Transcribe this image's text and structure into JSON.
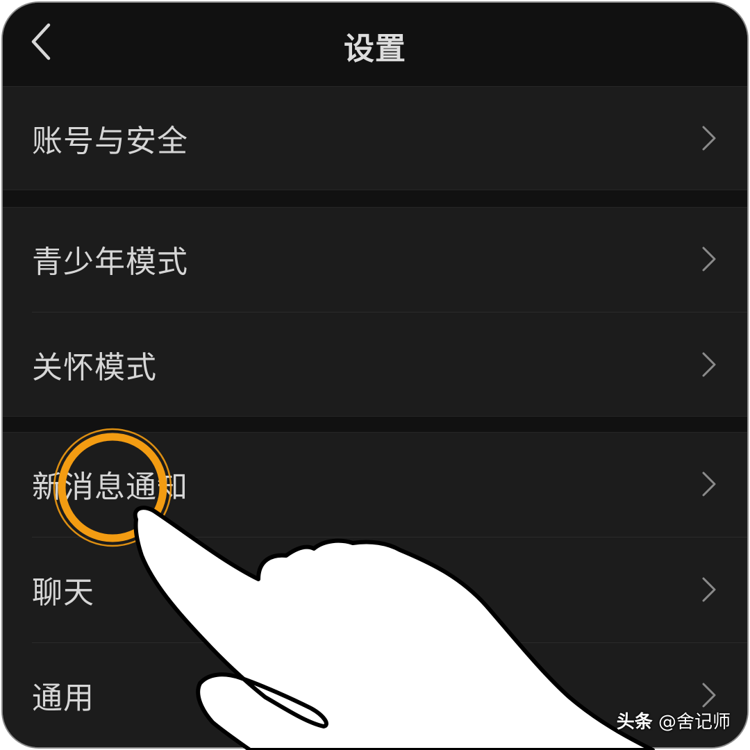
{
  "header": {
    "title": "设置",
    "back_icon": "chevron-left-icon"
  },
  "groups": [
    {
      "items": [
        {
          "label": "账号与安全",
          "icon": "chevron-right-icon"
        }
      ]
    },
    {
      "items": [
        {
          "label": "青少年模式",
          "icon": "chevron-right-icon"
        },
        {
          "label": "关怀模式",
          "icon": "chevron-right-icon"
        }
      ]
    },
    {
      "items": [
        {
          "label": "新消息通知",
          "icon": "chevron-right-icon"
        },
        {
          "label": "聊天",
          "icon": "chevron-right-icon"
        },
        {
          "label": "通用",
          "icon": "chevron-right-icon"
        }
      ]
    }
  ],
  "annotation": {
    "highlight_color": "#F39C12",
    "highlight_target": "新消息通知",
    "pointer_icon": "hand-pointer-icon"
  },
  "watermark": {
    "brand": "头条",
    "handle": "@舍记师"
  },
  "colors": {
    "background": "#111111",
    "row_background": "#1c1c1c",
    "text": "#d6d6d6",
    "chevron": "#8a8a8a"
  }
}
